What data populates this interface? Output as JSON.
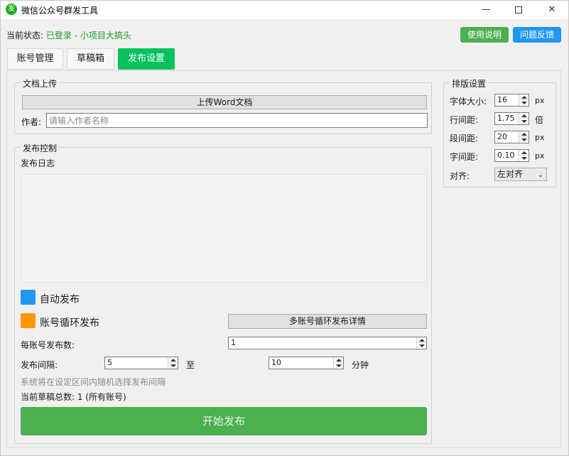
{
  "window": {
    "title": "微信公众号群发工具",
    "app_icon_glyph": "发",
    "minimize_glyph": "—",
    "close_glyph": "✕"
  },
  "status": {
    "label": "当前状态:",
    "value": "已登录 - 小项目大搞头",
    "value_color": "#1a9a1a"
  },
  "header_buttons": {
    "help": "使用说明",
    "feedback": "问题反馈",
    "help_color": "#4caf50",
    "feedback_color": "#2196f3"
  },
  "tabs": [
    {
      "label": "账号管理"
    },
    {
      "label": "草稿箱"
    },
    {
      "label": "发布设置",
      "active": true
    }
  ],
  "upload": {
    "group_title": "文档上传",
    "upload_button": "上传Word文档",
    "author_label": "作者:",
    "author_placeholder": "请输入作者名称",
    "author_value": ""
  },
  "publish": {
    "group_title": "发布控制",
    "log_label": "发布日志",
    "auto_publish_label": "自动发布",
    "auto_publish_color": "#2196f3",
    "cycle_publish_label": "账号循环发布",
    "cycle_publish_color": "#ff9800",
    "cycle_detail_button": "多账号循环发布详情",
    "per_account_label": "每账号发布数:",
    "per_account_value": "1",
    "interval_label": "发布间隔:",
    "interval_min": "5",
    "interval_to": "至",
    "interval_max": "10",
    "interval_unit": "分钟",
    "hint": "系统将在设定区间内随机选择发布间隔",
    "draft_count": "当前草稿总数: 1 (所有账号)",
    "start_button": "开始发布",
    "start_color": "#4caf50"
  },
  "layout": {
    "group_title": "排版设置",
    "font_size_label": "字体大小:",
    "font_size_value": "16",
    "font_size_unit": "px",
    "line_height_label": "行间距:",
    "line_height_value": "1.75",
    "line_height_unit": "倍",
    "paragraph_label": "段间距:",
    "paragraph_value": "20",
    "paragraph_unit": "px",
    "letter_label": "字间距:",
    "letter_value": "0.10",
    "letter_unit": "px",
    "align_label": "对齐:",
    "align_value": "左对齐"
  }
}
